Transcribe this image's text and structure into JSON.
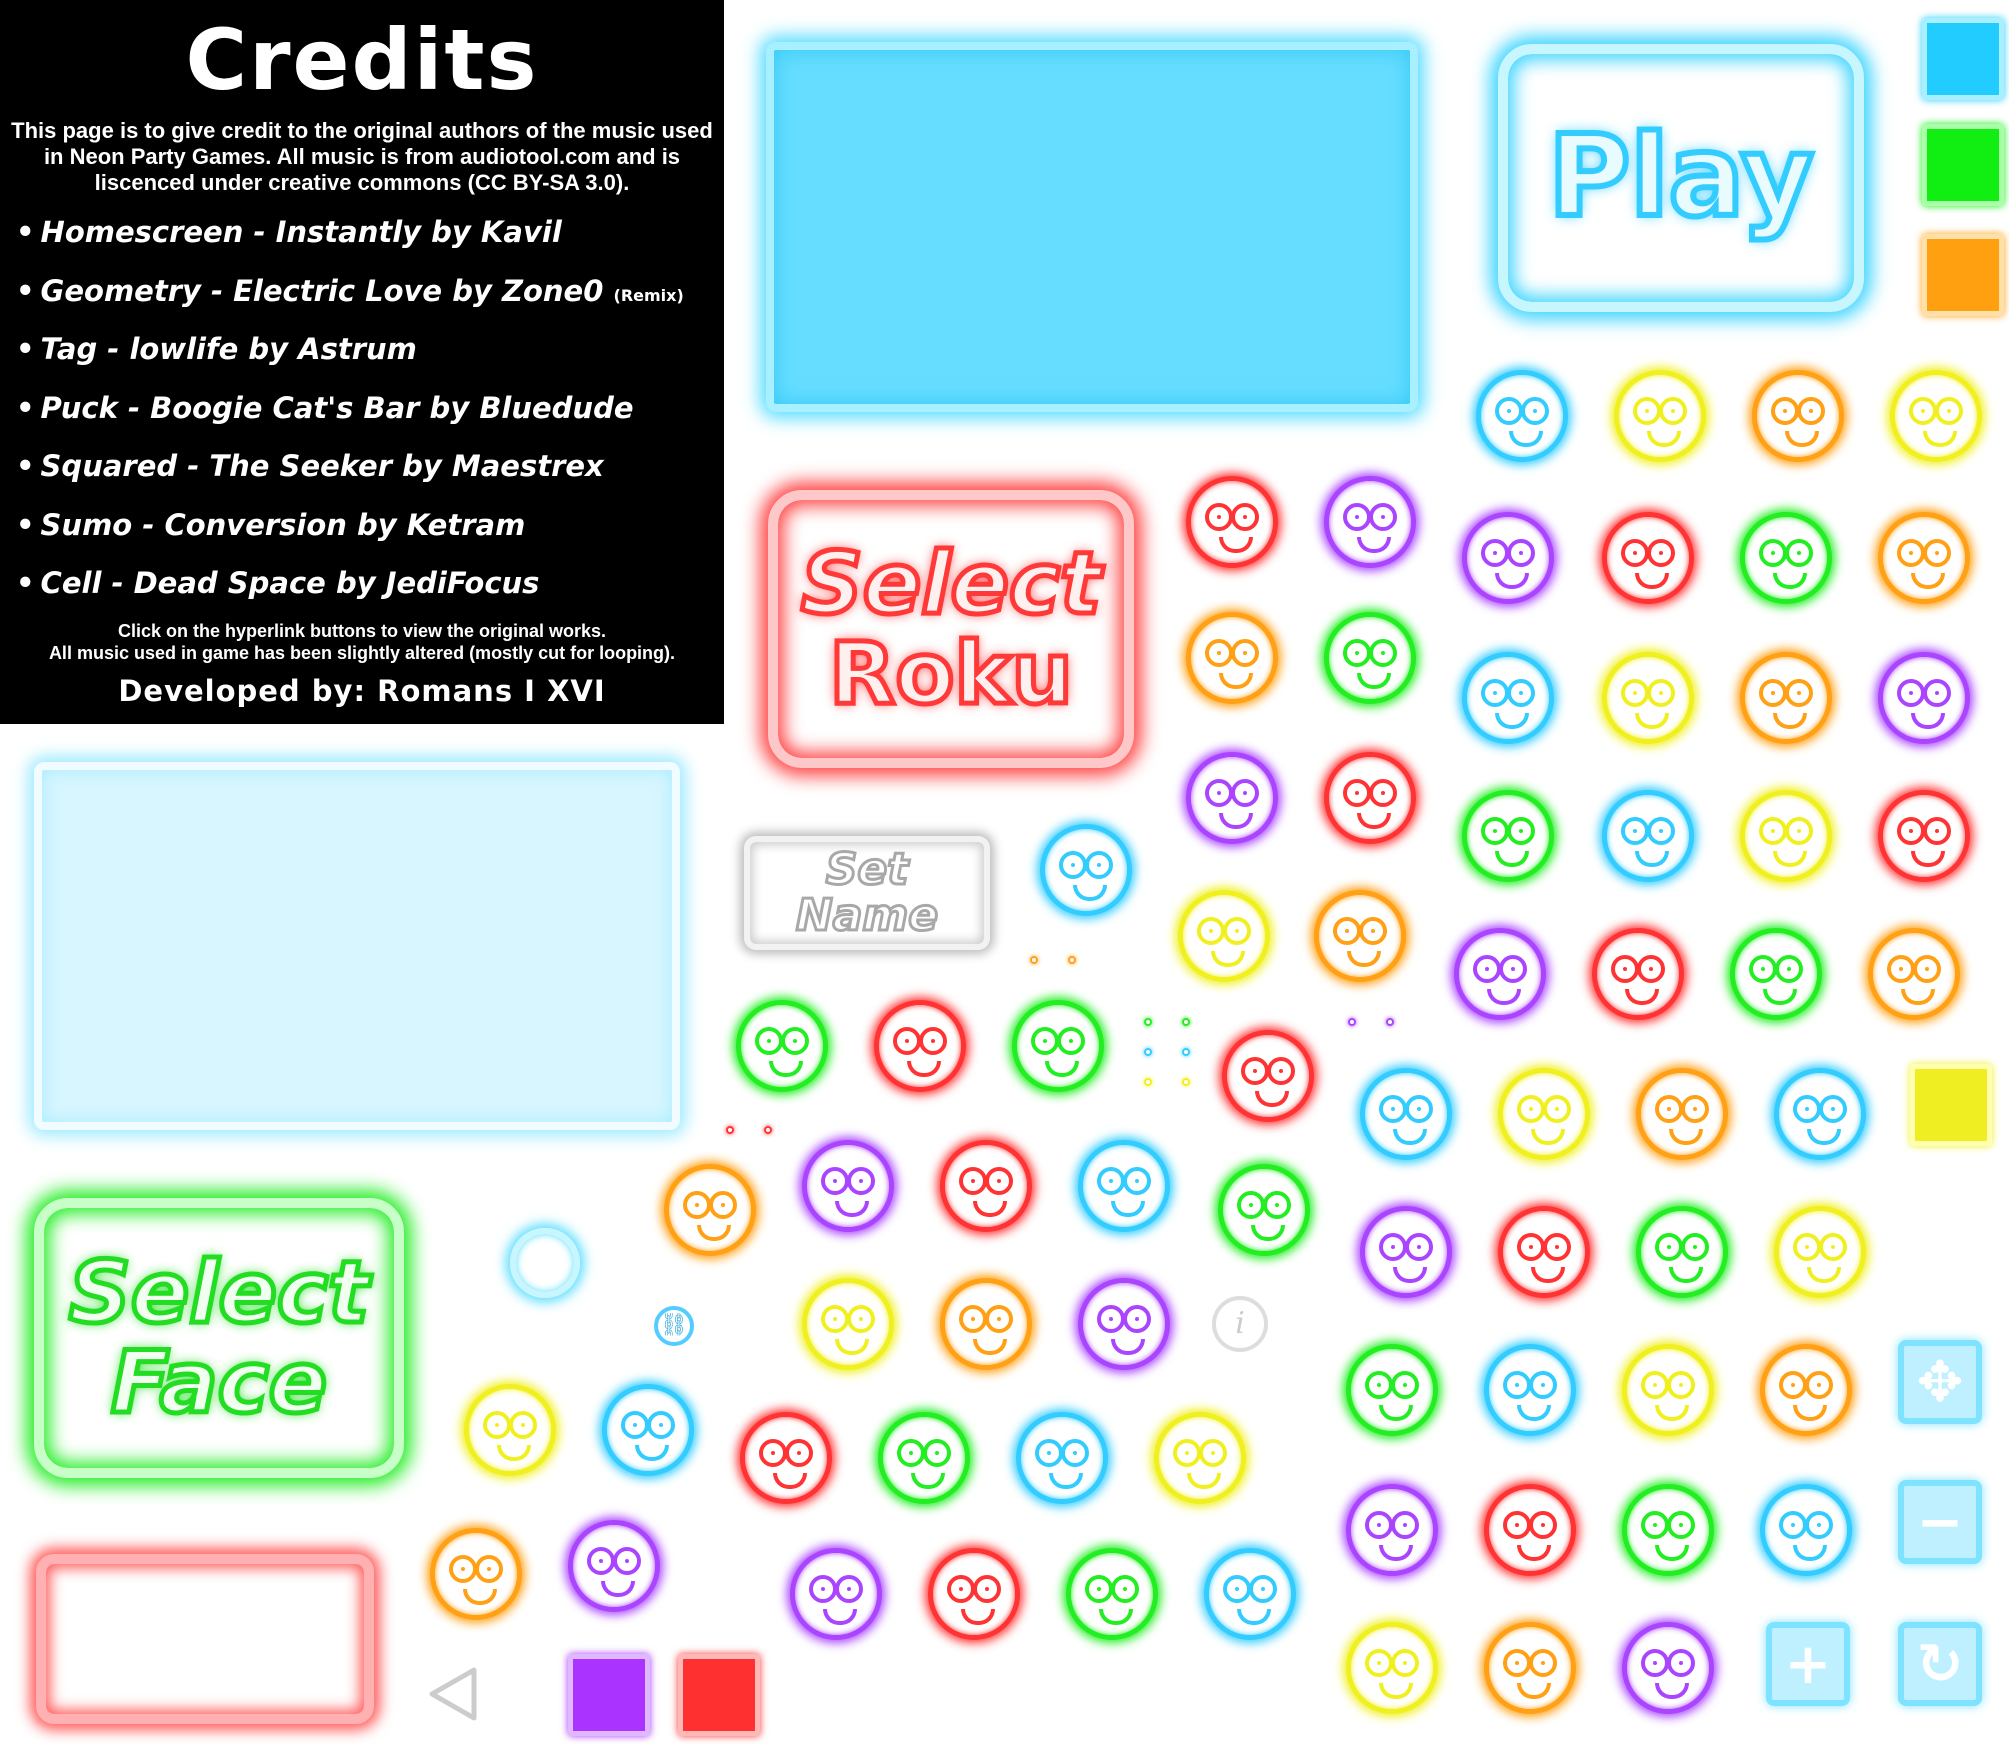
{
  "credits": {
    "title": "Credits",
    "intro": "This page is to give credit to the original authors of the music used in Neon Party Games. All music is from audiotool.com and is liscenced under creative commons (CC BY-SA 3.0).",
    "items": [
      {
        "text": "Homescreen - Instantly by Kavil",
        "tag": ""
      },
      {
        "text": "Geometry - Electric Love by Zone0",
        "tag": "(Remix)"
      },
      {
        "text": "Tag - lowlife by Astrum",
        "tag": ""
      },
      {
        "text": "Puck - Boogie Cat's Bar by Bluedude",
        "tag": ""
      },
      {
        "text": "Squared - The Seeker by Maestrex",
        "tag": ""
      },
      {
        "text": "Sumo - Conversion by Ketram",
        "tag": ""
      },
      {
        "text": "Cell - Dead Space by JediFocus",
        "tag": ""
      }
    ],
    "bullet": "•",
    "note_line1": "Click on the hyperlink buttons to view the original works.",
    "note_line2": "All music used in game has been slightly altered (mostly cut for looping).",
    "developer": "Developed by: Romans I XVI"
  },
  "buttons": {
    "play": "Play",
    "select_roku_1": "Select",
    "select_roku_2": "Roku",
    "set_name_1": "Set",
    "set_name_2": "Name",
    "select_face_1": "Select",
    "select_face_2": "Face"
  },
  "icons": {
    "back": "back-arrow-icon",
    "move": "move-arrows-icon",
    "minus": "minus-icon",
    "plus": "plus-icon",
    "rotate": "rotate-icon",
    "info": "info-icon",
    "link": "link-icon"
  },
  "colors": {
    "cyan": "#32ccff",
    "green": "#22ee22",
    "orange": "#ffa015",
    "yellow": "#f0f020",
    "red": "#ff3333",
    "purple": "#aa44ff",
    "gray": "#bbbbbb"
  }
}
